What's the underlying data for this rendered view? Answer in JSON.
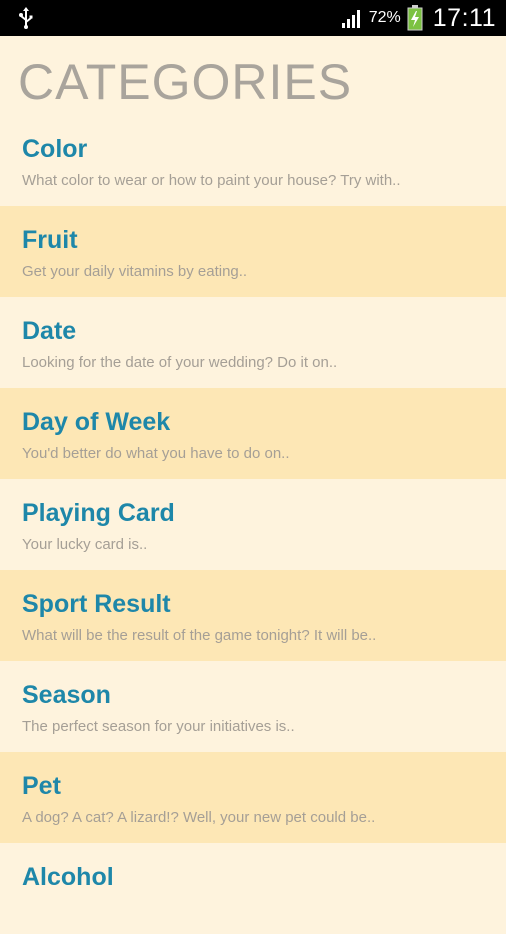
{
  "status_bar": {
    "battery_percent": "72%",
    "time": "17:11",
    "icons": [
      "usb-icon",
      "signal-icon",
      "battery-charging-icon"
    ]
  },
  "page": {
    "title": "CATEGORIES"
  },
  "categories": [
    {
      "title": "Color",
      "description": "What color to wear or how to paint your house? Try with.."
    },
    {
      "title": "Fruit",
      "description": "Get your daily vitamins by eating.."
    },
    {
      "title": "Date",
      "description": "Looking for the date of your wedding? Do it on.."
    },
    {
      "title": "Day of Week",
      "description": "You'd better do what you have to do on.."
    },
    {
      "title": "Playing Card",
      "description": "Your lucky card is.."
    },
    {
      "title": "Sport Result",
      "description": "What will be the result of the game tonight? It will be.."
    },
    {
      "title": "Season",
      "description": "The perfect season for your initiatives is.."
    },
    {
      "title": "Pet",
      "description": "A dog? A cat? A lizard!? Well, your new pet could be.."
    },
    {
      "title": "Alcohol",
      "description": ""
    }
  ],
  "colors": {
    "background": "#fef3dd",
    "alt_row": "#fde7b5",
    "title_text": "#1e87a9",
    "desc_text": "#a59f96",
    "heading_text": "#a9a49c"
  }
}
